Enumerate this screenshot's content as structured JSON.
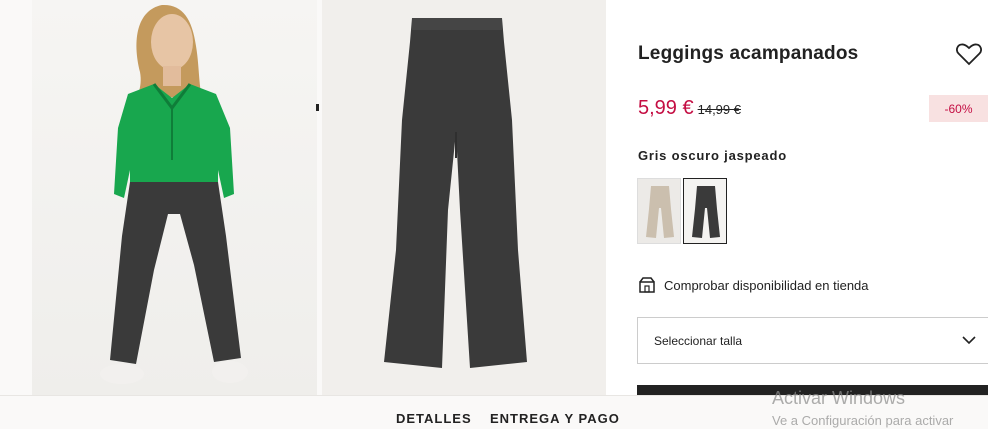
{
  "product": {
    "title": "Leggings acampanados",
    "price_now": "5,99 €",
    "price_old": "14,99 €",
    "discount": "-60%",
    "color_name": "Gris oscuro jaspeado",
    "availability": "Comprobar disponibilidad en tienda",
    "size_select": "Seleccionar talla"
  },
  "tabs": [
    "DETALLES",
    "ENTREGA Y PAGO"
  ],
  "watermark": {
    "line1": "Activar Windows",
    "line2": "Ve a Configuración para activar"
  },
  "colors": {
    "sale": "#c40e43",
    "discount_bg": "#f8e1e1",
    "garment_dark": "#3a3a3a",
    "sweater": "#18a74e",
    "beige": "#cbbfae"
  }
}
